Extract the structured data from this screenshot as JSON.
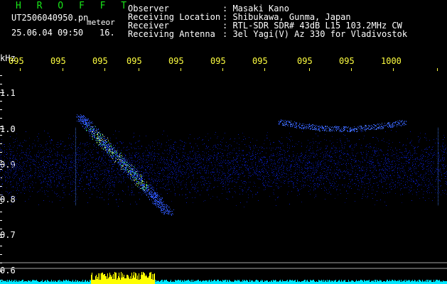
{
  "header": {
    "app_title": "H R O F F T",
    "filename": "UT2506040950.pn",
    "filename_suffix": "meteor",
    "datetime": "25.06.04 09:50",
    "count": "16.",
    "info": [
      {
        "label": "Observer",
        "value": ": Masaki Kano"
      },
      {
        "label": "Receiving Location",
        "value": ": Shibukawa, Gunma, Japan"
      },
      {
        "label": "Receiver",
        "value": ": RTL-SDR SDR# 43dB L15 103.2MHz CW"
      },
      {
        "label": "Receiving Antenna",
        "value": ": 3el Yagi(V) Az 330 for Vladivostok"
      }
    ]
  },
  "spectrogram": {
    "y_unit": "kHz",
    "y_ticks": [
      "1.1",
      "1.0",
      "0.9",
      "0.8",
      "0.7",
      "0.6"
    ],
    "x_ticks": [
      "095",
      "095",
      "095",
      "095",
      "095",
      "095",
      "095",
      "095",
      "095",
      "1000"
    ],
    "colors": {
      "background": "#000000",
      "noise": "#1a2fa8",
      "signal": "#3ad14a",
      "ticks": "#ffff40",
      "baseline": "#00e5ff",
      "burst": "#ffff00"
    }
  }
}
